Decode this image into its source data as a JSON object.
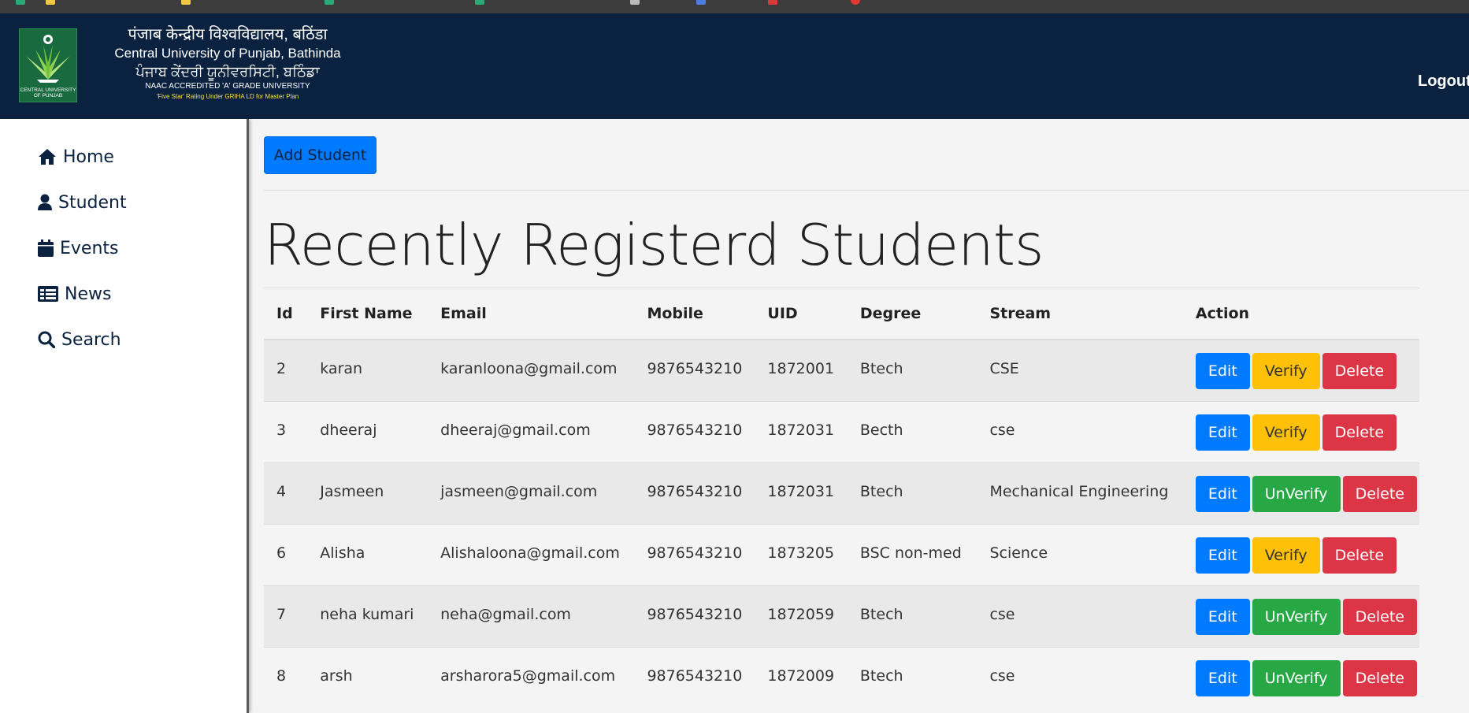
{
  "colors": {
    "header_bg": "#0a2240",
    "primary": "#007bff",
    "warning": "#ffc107",
    "success": "#28a745",
    "danger": "#dc3545"
  },
  "header": {
    "logo_text": "CENTRAL UNIVERSITY OF PUNJAB",
    "name_hindi": "पंजाब केन्द्रीय विश्वविद्यालय, बठिंडा",
    "name_english": "Central University of Punjab, Bathinda",
    "name_punjabi": "ਪੰਜਾਬ ਕੇਂਦਰੀ ਯੂਨੀਵਰਸਿਟੀ, ਬਠਿੰਡਾ",
    "accreditation": "NAAC ACCREDITED 'A' GRADE UNIVERSITY",
    "rating": "'Five Star' Rating Under GRIHA LD for Master Plan",
    "logout_label": "Logout"
  },
  "sidebar": {
    "items": [
      {
        "label": "Home",
        "icon": "home-icon"
      },
      {
        "label": "Student",
        "icon": "user-icon"
      },
      {
        "label": "Events",
        "icon": "calendar-icon"
      },
      {
        "label": "News",
        "icon": "newspaper-icon"
      },
      {
        "label": "Search",
        "icon": "search-icon"
      }
    ]
  },
  "main": {
    "add_button_label": "Add Student",
    "title": "Recently Registerd Students",
    "table": {
      "headers": [
        "Id",
        "First Name",
        "Email",
        "Mobile",
        "UID",
        "Degree",
        "Stream",
        "Action"
      ],
      "edit_label": "Edit",
      "verify_label": "Verify",
      "unverify_label": "UnVerify",
      "delete_label": "Delete",
      "rows": [
        {
          "id": "2",
          "first_name": "karan",
          "email": "karanloona@gmail.com",
          "mobile": "9876543210",
          "uid": "1872001",
          "degree": "Btech",
          "stream": "CSE",
          "verified": false
        },
        {
          "id": "3",
          "first_name": "dheeraj",
          "email": "dheeraj@gmail.com",
          "mobile": "9876543210",
          "uid": "1872031",
          "degree": "Becth",
          "stream": "cse",
          "verified": false
        },
        {
          "id": "4",
          "first_name": "Jasmeen",
          "email": "jasmeen@gmail.com",
          "mobile": "9876543210",
          "uid": "1872031",
          "degree": "Btech",
          "stream": "Mechanical Engineering",
          "verified": true
        },
        {
          "id": "6",
          "first_name": "Alisha",
          "email": "Alishaloona@gmail.com",
          "mobile": "9876543210",
          "uid": "1873205",
          "degree": "BSC non-med",
          "stream": "Science",
          "verified": false
        },
        {
          "id": "7",
          "first_name": "neha kumari",
          "email": "neha@gmail.com",
          "mobile": "9876543210",
          "uid": "1872059",
          "degree": "Btech",
          "stream": "cse",
          "verified": true
        },
        {
          "id": "8",
          "first_name": "arsh",
          "email": "arsharora5@gmail.com",
          "mobile": "9876543210",
          "uid": "1872009",
          "degree": "Btech",
          "stream": "cse",
          "verified": true
        }
      ]
    }
  }
}
